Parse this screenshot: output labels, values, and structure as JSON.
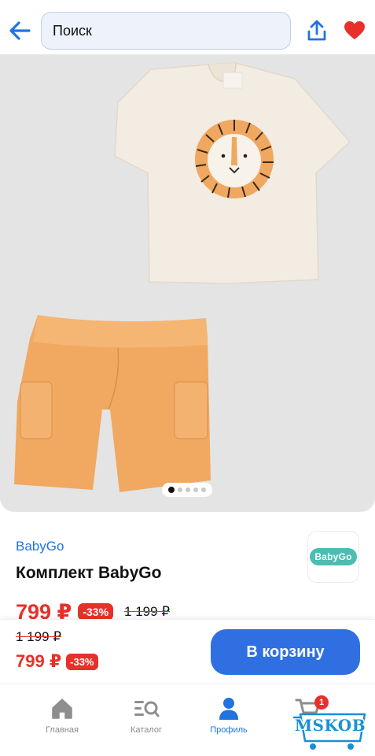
{
  "header": {
    "search_placeholder": "Поиск",
    "icons": {
      "back": "arrow-left-icon",
      "share": "share-icon",
      "favorite": "heart-icon"
    }
  },
  "gallery": {
    "image_count": 5,
    "active_index": 0
  },
  "product": {
    "brand": "BabyGo",
    "brand_logo_text": "BabyGo",
    "title": "Комплект BabyGo",
    "price": "799 ₽",
    "discount": "-33%",
    "old_price": "1 199 ₽"
  },
  "buy_bar": {
    "old_price": "1 199 ₽",
    "price": "799 ₽",
    "discount": "-33%",
    "cart_button": "В корзину"
  },
  "bottom_nav": {
    "items": [
      {
        "label": "Главная",
        "icon": "home-icon"
      },
      {
        "label": "Каталог",
        "icon": "catalog-icon"
      },
      {
        "label": "Профиль",
        "icon": "profile-icon",
        "active": true
      },
      {
        "label": "",
        "icon": "cart-icon",
        "badge": "1"
      }
    ]
  },
  "watermark": {
    "text": "MSKOB"
  },
  "colors": {
    "accent": "#2f6fe2",
    "link": "#1f74e0",
    "sale": "#e8302a",
    "favorite": "#e8302a",
    "logo": "#4dbdb1"
  }
}
